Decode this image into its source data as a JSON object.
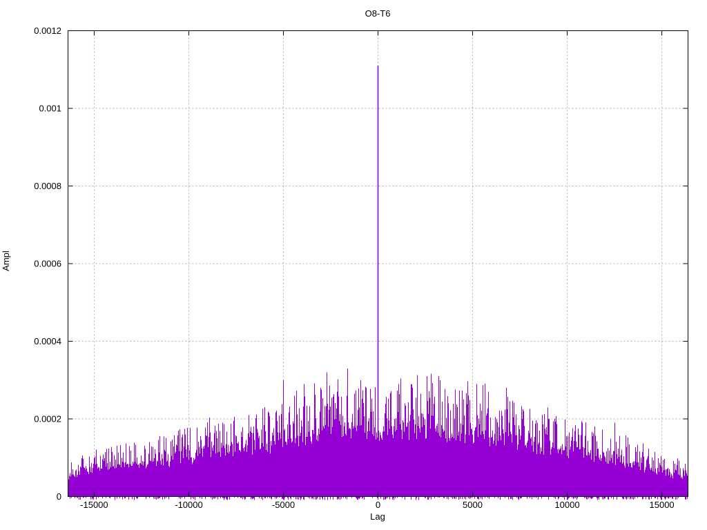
{
  "figure": {
    "background": "#ffffff"
  },
  "chart_data": {
    "type": "impulses",
    "title": "O8-T6",
    "xlabel": "Lag",
    "ylabel": "Ampl",
    "xlim": [
      -16384,
      16384
    ],
    "ylim": [
      0,
      0.0012
    ],
    "grid": true,
    "legend": "none",
    "xticks": [
      {
        "v": -15000,
        "label": "-15000"
      },
      {
        "v": -10000,
        "label": "-10000"
      },
      {
        "v": -5000,
        "label": "-5000"
      },
      {
        "v": 0,
        "label": "0"
      },
      {
        "v": 5000,
        "label": "5000"
      },
      {
        "v": 10000,
        "label": "10000"
      },
      {
        "v": 15000,
        "label": "15000"
      }
    ],
    "yticks": [
      {
        "v": 0,
        "label": "0"
      },
      {
        "v": 0.0002,
        "label": "0.0002"
      },
      {
        "v": 0.0004,
        "label": "0.0004"
      },
      {
        "v": 0.0006,
        "label": "0.0006"
      },
      {
        "v": 0.0008,
        "label": "0.0008"
      },
      {
        "v": 0.001,
        "label": "0.001"
      },
      {
        "v": 0.0012,
        "label": "0.0012"
      }
    ],
    "colors": {
      "line": "#9400d3",
      "grid": "#b0b0b0",
      "axis": "#000000",
      "text": "#000000",
      "background": "#ffffff"
    },
    "center_peak": {
      "lag": 0,
      "ampl": 0.00111
    },
    "feature_spikes": [
      [
        -5000,
        0.0003
      ],
      [
        -2700,
        0.00032
      ],
      [
        -1600,
        0.00033
      ],
      [
        -900,
        0.0003
      ],
      [
        -3900,
        0.00029
      ],
      [
        1100,
        0.00029
      ],
      [
        2600,
        0.00031
      ],
      [
        3200,
        0.00031
      ],
      [
        5200,
        0.00029
      ],
      [
        6800,
        0.00028
      ],
      [
        10800,
        0.00019
      ],
      [
        12500,
        0.00019
      ]
    ],
    "noise_envelope": [
      [
        -16384,
        8.5e-05
      ],
      [
        -16000,
        0.0001
      ],
      [
        -15000,
        0.00012
      ],
      [
        -14000,
        0.00013
      ],
      [
        -13000,
        0.00014
      ],
      [
        -12000,
        0.00015
      ],
      [
        -11000,
        0.00016
      ],
      [
        -10000,
        0.00017
      ],
      [
        -9000,
        0.00019
      ],
      [
        -8000,
        0.0002
      ],
      [
        -7000,
        0.00021
      ],
      [
        -6000,
        0.00022
      ],
      [
        -5000,
        0.00026
      ],
      [
        -4000,
        0.00026
      ],
      [
        -3000,
        0.0003
      ],
      [
        -2000,
        0.00031
      ],
      [
        -1000,
        0.0003
      ],
      [
        0,
        0.0003
      ],
      [
        1000,
        0.00029
      ],
      [
        2000,
        0.0003
      ],
      [
        3000,
        0.00031
      ],
      [
        4000,
        0.00027
      ],
      [
        5000,
        0.00028
      ],
      [
        6000,
        0.00027
      ],
      [
        7000,
        0.00026
      ],
      [
        8000,
        0.00023
      ],
      [
        9000,
        0.00022
      ],
      [
        10000,
        0.0002
      ],
      [
        11000,
        0.00019
      ],
      [
        12000,
        0.00016
      ],
      [
        13000,
        0.00015
      ],
      [
        14000,
        0.00013
      ],
      [
        15000,
        0.00011
      ],
      [
        16000,
        9e-05
      ],
      [
        16384,
        8.5e-05
      ]
    ],
    "base_fraction": 0.54,
    "render": {
      "seed": 1337,
      "tall_spike_prob": 0.045,
      "negative_speck_prob": 0.3,
      "negative_speck_max": -6e-06
    }
  }
}
